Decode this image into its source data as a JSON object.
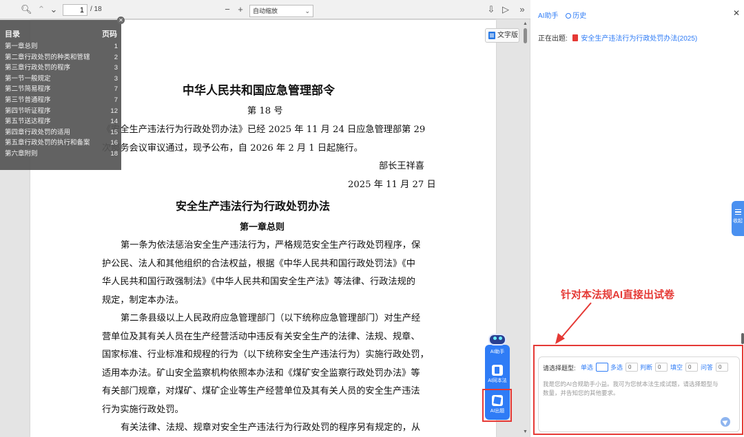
{
  "toolbar": {
    "page_current": "1",
    "page_total": "/ 18",
    "zoom": "自动缩放"
  },
  "text_version_label": "文字版",
  "toc": {
    "title": "目录",
    "page_col": "页码",
    "items": [
      {
        "label": "第一章总则",
        "page": "1"
      },
      {
        "label": "第二章行政处罚的种类和管辖",
        "page": "2"
      },
      {
        "label": "第三章行政处罚的程序",
        "page": "3"
      },
      {
        "label": "第一节一般规定",
        "page": "3"
      },
      {
        "label": "第二节简易程序",
        "page": "7"
      },
      {
        "label": "第三节普通程序",
        "page": "7"
      },
      {
        "label": "第四节听证程序",
        "page": "12"
      },
      {
        "label": "第五节送达程序",
        "page": "14"
      },
      {
        "label": "第四章行政处罚的适用",
        "page": "15"
      },
      {
        "label": "第五章行政处罚的执行和备案",
        "page": "16"
      },
      {
        "label": "第六章附则",
        "page": "18"
      }
    ]
  },
  "doc": {
    "order_title": "中华人民共和国应急管理部令",
    "order_no": "第 18 号",
    "intro1": "《安全生产违法行为行政处罚办法》已经 2025 年 11 月 24 日应急管理部第 29",
    "intro2": "次部务会议审议通过，现予公布，自 2026 年 2 月 1 日起施行。",
    "minister": "部长王祥喜",
    "date": "2025 年 11 月 27 日",
    "law_title": "安全生产违法行为行政处罚办法",
    "chapter1": "第一章总则",
    "p1_1": "第一条为依法惩治安全生产违法行为，严格规范安全生产行政处罚程序，保",
    "p1_2": "护公民、法人和其他组织的合法权益，根据《中华人民共和国行政处罚法》《中",
    "p1_3": "华人民共和国行政强制法》《中华人民共和国安全生产法》等法律、行政法规的",
    "p1_4": "规定，制定本办法。",
    "p2_1": "第二条县级以上人民政府应急管理部门（以下统称应急管理部门）对生产经",
    "p2_2": "营单位及其有关人员在生产经营活动中违反有关安全生产的法律、法规、规章、",
    "p2_3": "国家标准、行业标准和规程的行为（以下统称安全生产违法行为）实施行政处罚，",
    "p2_4": "适用本办法。矿山安全监察机构依照本办法和《煤矿安全监察行政处罚办法》等",
    "p2_5": "有关部门规章，对煤矿、煤矿企业等生产经营单位及其有关人员的安全生产违法",
    "p2_6": "行为实施行政处罚。",
    "p3_1": "有关法律、法规、规章对安全生产违法行为行政处罚的程序另有规定的，从"
  },
  "float_buttons": {
    "ai_assistant": "AI助手",
    "ai_same_law": "AI同本法",
    "ai_quiz": "AI出题"
  },
  "side": {
    "tab_ai": "AI助手",
    "tab_history": "历史",
    "current_label": "正在出题:",
    "current_doc": "安全生产违法行为行政处罚办法(2025)",
    "collapse": "收起",
    "annotation": "针对本法规AI直接出试卷",
    "qtype_label": "请选择题型:",
    "qtypes": [
      {
        "label": "单选",
        "count": ""
      },
      {
        "label": "多选",
        "count": "0"
      },
      {
        "label": "判断",
        "count": "0"
      },
      {
        "label": "填空",
        "count": "0"
      },
      {
        "label": "问答",
        "count": "0"
      }
    ],
    "hint": "我是您的AI合规助手小益。我可为您就本法生成试题，请选择题型与数量，并告知您的其他要求。"
  },
  "colors": {
    "accent": "#2f7cf6",
    "annotation": "#e53935"
  }
}
